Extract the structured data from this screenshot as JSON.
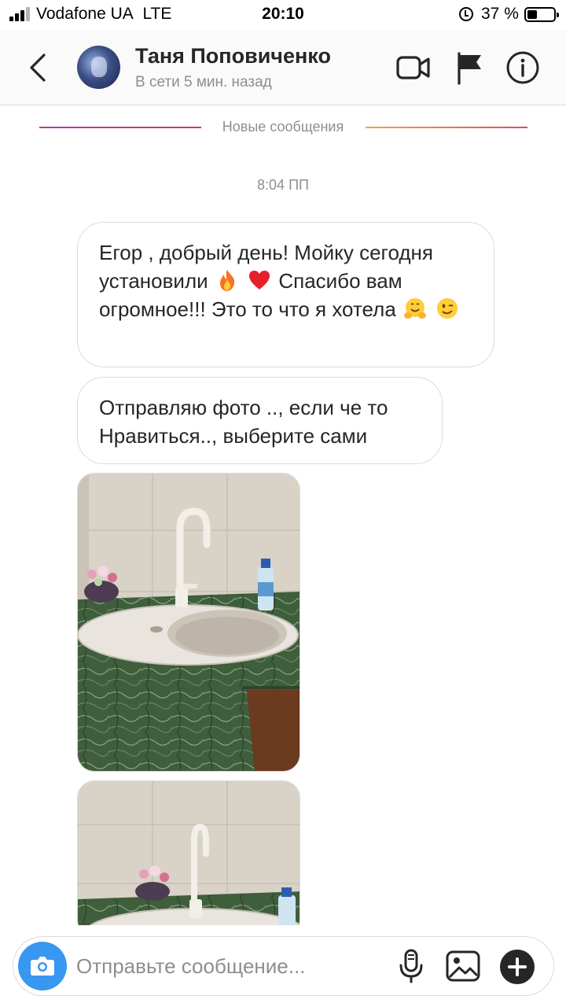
{
  "status_bar": {
    "carrier": "Vodafone UA",
    "network": "LTE",
    "time": "20:10",
    "battery_percent": "37 %",
    "battery_level": 0.37,
    "signal_bars": 3,
    "icons": [
      "signal-icon",
      "alarm-icon",
      "battery-icon"
    ]
  },
  "header": {
    "contact_name": "Таня Поповиченко",
    "contact_status": "В сети 5 мин. назад",
    "icons": [
      "back-icon",
      "avatar",
      "video-call-icon",
      "flag-icon",
      "info-icon"
    ]
  },
  "divider": {
    "label": "Новые сообщения"
  },
  "conversation": {
    "timestamp": "8:04 ПП",
    "messages": [
      {
        "type": "text",
        "parts": [
          "Егор , добрый день! Мойку сегодня установили",
          "Спасибо вам огромное!!! Это то что я хотела"
        ],
        "emojis": [
          "fire-emoji",
          "red-heart-emoji",
          "hugging-face-emoji",
          "winking-face-emoji"
        ]
      },
      {
        "type": "text",
        "text_line1": "Отправляю фото .., если че то",
        "text_line2": "Нравиться.., выберите сами"
      },
      {
        "type": "photo",
        "subject": "kitchen-sink-photo"
      },
      {
        "type": "photo",
        "subject": "kitchen-sink-photo"
      }
    ]
  },
  "composer": {
    "placeholder": "Отправьте сообщение...",
    "icons": [
      "camera-icon",
      "microphone-icon",
      "gallery-icon",
      "plus-icon"
    ]
  },
  "colors": {
    "accent_blue": "#3897f0",
    "text_primary": "#262626",
    "text_secondary": "#8e8e8e",
    "border": "#dbdbdb",
    "header_bg": "#fafafa"
  }
}
